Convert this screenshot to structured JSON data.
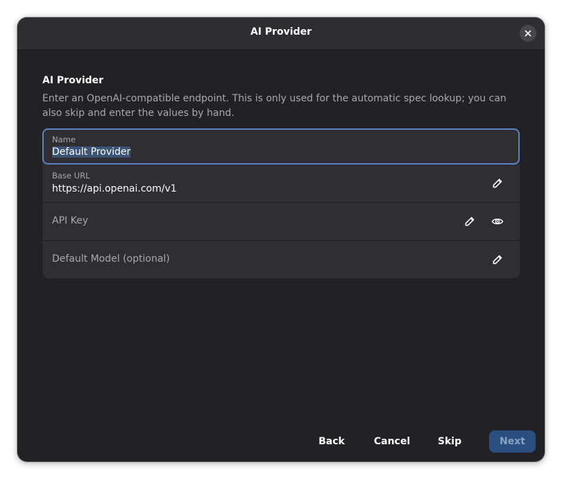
{
  "header": {
    "title": "AI Provider",
    "close_icon": "close-icon"
  },
  "section": {
    "title": "AI Provider",
    "description": "Enter an OpenAI-compatible endpoint. This is only used for the automatic spec lookup; you can also skip and enter the values by hand."
  },
  "fields": {
    "name": {
      "label": "Name",
      "value": "Default Provider"
    },
    "base_url": {
      "label": "Base URL",
      "value": "https://api.openai.com/v1",
      "icon": "pencil-icon"
    },
    "api_key": {
      "placeholder": "API Key",
      "icons": [
        "pencil-icon",
        "eye-icon"
      ]
    },
    "default_model": {
      "placeholder": "Default Model (optional)",
      "icon": "pencil-icon"
    }
  },
  "footer": {
    "back_label": "Back",
    "cancel_label": "Cancel",
    "skip_label": "Skip",
    "next_label": "Next"
  },
  "colors": {
    "dialog_bg": "#222226",
    "header_bg": "#2e2e32",
    "row_bg": "#2e2e33",
    "focus_border": "#5b84c4",
    "selection": "#3a5579",
    "next_bg": "#2a4e80",
    "muted_text": "#a8a8ad"
  }
}
